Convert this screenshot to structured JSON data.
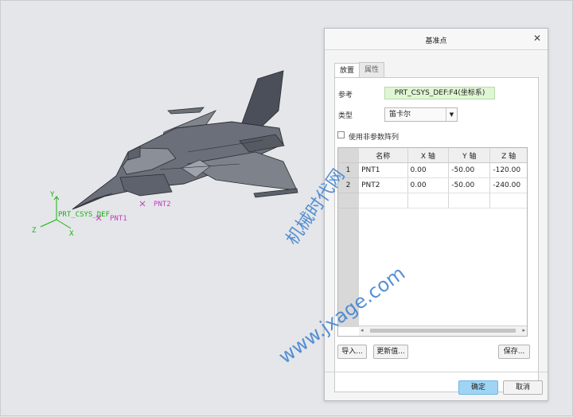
{
  "dialog": {
    "title": "基准点",
    "close_icon": "close-icon",
    "tabs": [
      {
        "label": "放置",
        "active": true
      },
      {
        "label": "属性",
        "active": false
      }
    ],
    "reference_label": "参考",
    "reference_value": "PRT_CSYS_DEF:F4(坐标系)",
    "type_label": "类型",
    "type_value": "笛卡尔",
    "checkbox_label": "使用非参数阵列",
    "table": {
      "columns": [
        "名称",
        "X 轴",
        "Y 轴",
        "Z 轴"
      ],
      "rows": [
        {
          "index": "1",
          "name": "PNT1",
          "x": "0.00",
          "y": "-50.00",
          "z": "-120.00"
        },
        {
          "index": "2",
          "name": "PNT2",
          "x": "0.00",
          "y": "-50.00",
          "z": "-240.00"
        }
      ]
    },
    "import_button": "导入...",
    "update_button": "更新值...",
    "save_button": "保存...",
    "ok_button": "确定",
    "cancel_button": "取消"
  },
  "viewport": {
    "csys_label": "PRT_CSYS_DEF",
    "axis_x": "X",
    "axis_y": "Y",
    "axis_z": "Z",
    "point1_label": "PNT1",
    "point2_label": "PNT2"
  },
  "watermark": {
    "line1": "机械时代网",
    "line2": "www.jxage.com"
  },
  "colors": {
    "accent": "#9fd4f5",
    "reference_bg": "#dff6d4",
    "csys_green": "#19b10f",
    "point_magenta": "#c43cc4",
    "watermark": "#3a7fd0"
  }
}
